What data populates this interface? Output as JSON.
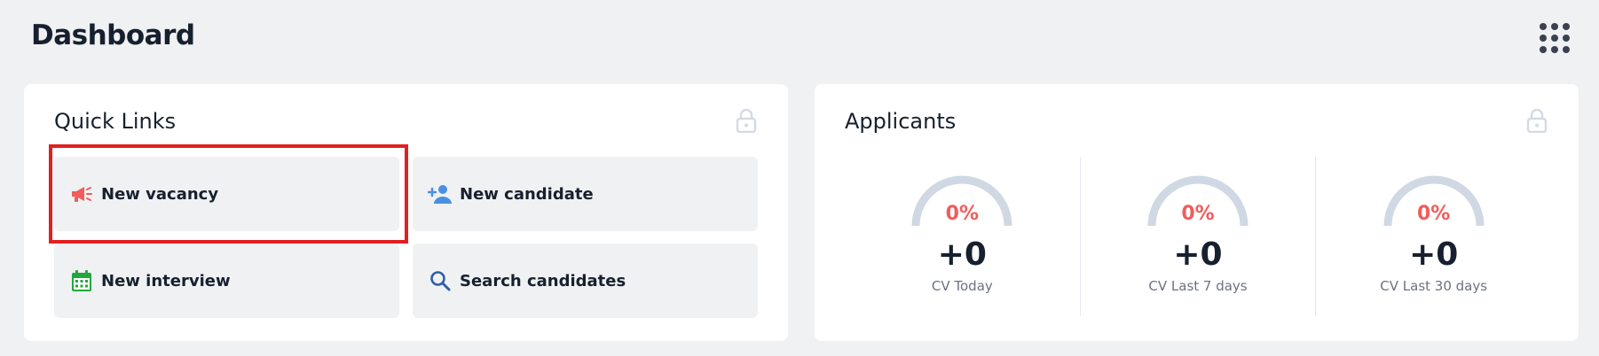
{
  "header": {
    "title": "Dashboard",
    "apps_icon": "grid-dots-icon"
  },
  "quick_links": {
    "title": "Quick Links",
    "lock_icon": "lock-icon",
    "items": [
      {
        "label": "New vacancy",
        "icon": "megaphone-icon",
        "color": "#f25c5c",
        "highlighted": true
      },
      {
        "label": "New candidate",
        "icon": "add-user-icon",
        "color": "#4a90e2"
      },
      {
        "label": "New interview",
        "icon": "calendar-icon",
        "color": "#22a83a"
      },
      {
        "label": "Search candidates",
        "icon": "search-icon",
        "color": "#2f5ea8"
      }
    ]
  },
  "applicants": {
    "title": "Applicants",
    "lock_icon": "lock-icon",
    "metrics": [
      {
        "percent": "0%",
        "count": "+0",
        "label": "CV Today"
      },
      {
        "percent": "0%",
        "count": "+0",
        "label": "CV Last 7 days"
      },
      {
        "percent": "0%",
        "count": "+0",
        "label": "CV Last 30 days"
      }
    ]
  },
  "colors": {
    "accent_red": "#f25c5c",
    "highlight_border": "#e0201f",
    "gauge_track": "#cfd8e3",
    "background": "#eff1f3"
  }
}
